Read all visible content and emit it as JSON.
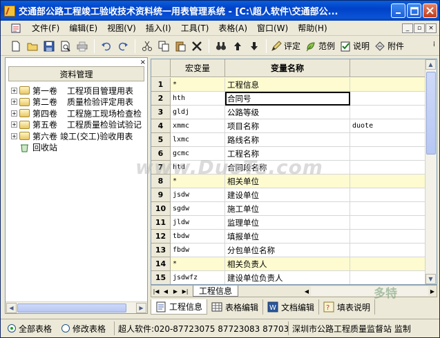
{
  "window": {
    "title": "交通部公路工程竣工验收技术资料统一用表管理系统 - [C:\\超人软件\\交通部公..."
  },
  "menubar": {
    "items": [
      {
        "label": "文件(F)"
      },
      {
        "label": "编辑(E)"
      },
      {
        "label": "视图(V)"
      },
      {
        "label": "插入(I)"
      },
      {
        "label": "工具(T)"
      },
      {
        "label": "表格(A)"
      },
      {
        "label": "窗口(W)"
      },
      {
        "label": "帮助(H)"
      }
    ]
  },
  "toolbar": {
    "labeled": [
      {
        "label": "评定",
        "icon": "pen-check-icon"
      },
      {
        "label": "范例",
        "icon": "sample-icon"
      },
      {
        "label": "说明",
        "icon": "clipboard-check-icon"
      },
      {
        "label": "附件",
        "icon": "attachment-icon"
      }
    ]
  },
  "leftpanel": {
    "header": "资料管理",
    "tree": [
      {
        "vol": "第一卷",
        "title": "工程项目管理用表"
      },
      {
        "vol": "第二卷",
        "title": "质量检验评定用表"
      },
      {
        "vol": "第四卷",
        "title": "工程施工现场检查检"
      },
      {
        "vol": "第五卷",
        "title": "工程质量检验试验记"
      },
      {
        "vol": "第六卷",
        "title": "竣工(交工)验收用表"
      }
    ],
    "recycle": "回收站"
  },
  "grid": {
    "headers": [
      "",
      "宏变量",
      "变量名称",
      ""
    ],
    "rows": [
      {
        "n": "1",
        "code": "*",
        "name": "工程信息",
        "extra": "",
        "hl": true
      },
      {
        "n": "2",
        "code": "hth",
        "name": "合同号",
        "extra": "",
        "hl": false
      },
      {
        "n": "3",
        "code": "gldj",
        "name": "公路等级",
        "extra": "",
        "hl": false
      },
      {
        "n": "4",
        "code": "xmmc",
        "name": "项目名称",
        "extra": "duote",
        "hl": false
      },
      {
        "n": "5",
        "code": "lxmc",
        "name": "路线名称",
        "extra": "",
        "hl": false
      },
      {
        "n": "6",
        "code": "gcmc",
        "name": "工程名称",
        "extra": "",
        "hl": false
      },
      {
        "n": "7",
        "code": "htd",
        "name": "合同段名称",
        "extra": "",
        "hl": false
      },
      {
        "n": "8",
        "code": "*",
        "name": "相关单位",
        "extra": "",
        "hl": true
      },
      {
        "n": "9",
        "code": "jsdw",
        "name": "建设单位",
        "extra": "",
        "hl": false
      },
      {
        "n": "10",
        "code": "sgdw",
        "name": "施工单位",
        "extra": "",
        "hl": false
      },
      {
        "n": "11",
        "code": "jldw",
        "name": "监理单位",
        "extra": "",
        "hl": false
      },
      {
        "n": "12",
        "code": "tbdw",
        "name": "填报单位",
        "extra": "",
        "hl": false
      },
      {
        "n": "13",
        "code": "fbdw",
        "name": "分包单位名称",
        "extra": "",
        "hl": false
      },
      {
        "n": "14",
        "code": "*",
        "name": "相关负责人",
        "extra": "",
        "hl": true
      },
      {
        "n": "15",
        "code": "jsdwfz",
        "name": "建设单位负责人",
        "extra": "",
        "hl": false
      }
    ],
    "selected_row": "2"
  },
  "sheetbar": {
    "tab": "工程信息"
  },
  "bottomtabs": [
    {
      "label": "工程信息",
      "icon": "doc-icon",
      "active": true
    },
    {
      "label": "表格编辑",
      "icon": "table-icon",
      "active": false
    },
    {
      "label": "文档编辑",
      "icon": "word-icon",
      "active": false
    },
    {
      "label": "填表说明",
      "icon": "help-icon",
      "active": false
    }
  ],
  "statusbar": {
    "radio_all": "全部表格",
    "radio_modified": "修改表格",
    "company": "超人软件:020-87723075 87723083 87703078",
    "org": "深圳市公路工程质量监督站 监制"
  },
  "watermark": "www.DuoTe.com",
  "watermark2": "多特"
}
